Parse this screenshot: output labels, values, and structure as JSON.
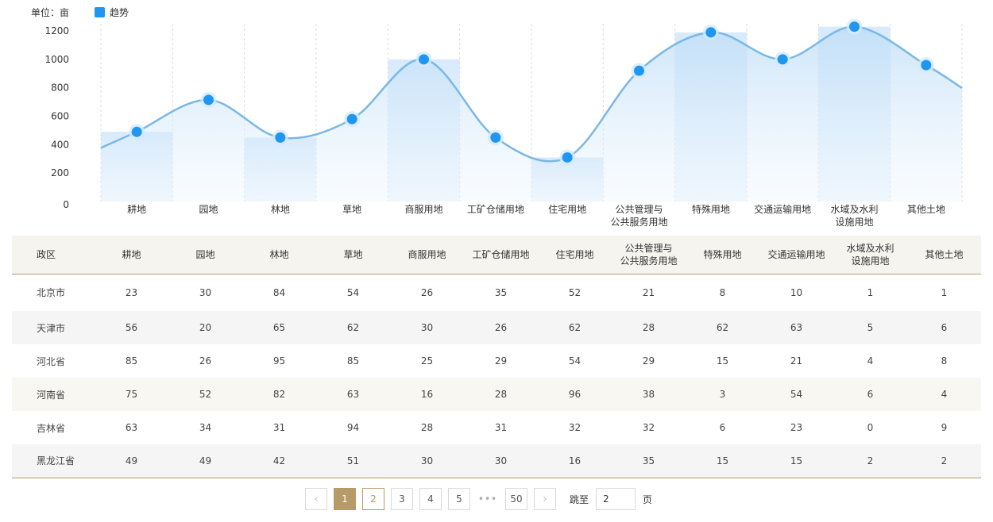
{
  "chart_data": {
    "type": "area",
    "unit_label": "单位：亩",
    "legend": [
      {
        "name": "趋势",
        "color": "#1e96f2"
      }
    ],
    "categories": [
      "耕地",
      "园地",
      "林地",
      "草地",
      "商服用地",
      "工矿仓储用地",
      "住宅用地",
      "公共管理与\n公共服务用地",
      "特殊用地",
      "交通运输用地",
      "水域及水利\n设施用地",
      "其他土地"
    ],
    "series": [
      {
        "name": "趋势",
        "values": [
          490,
          715,
          450,
          580,
          1000,
          450,
          310,
          920,
          1190,
          1000,
          1230,
          960
        ]
      }
    ],
    "ylim": [
      0,
      1200
    ],
    "yticks": [
      0,
      200,
      400,
      600,
      800,
      1000,
      1200
    ],
    "grid": "vertical-dashed",
    "line_color": "#7ab8e6",
    "point_color": "#1e96f2"
  },
  "table": {
    "headers": [
      "政区",
      "耕地",
      "园地",
      "林地",
      "草地",
      "商服用地",
      "工矿仓储用地",
      "住宅用地",
      "公共管理与\n公共服务用地",
      "特殊用地",
      "交通运输用地",
      "水域及水利\n设施用地",
      "其他土地"
    ],
    "rows": [
      [
        "北京市",
        "23",
        "30",
        "84",
        "54",
        "26",
        "35",
        "52",
        "21",
        "8",
        "10",
        "1",
        "1"
      ],
      [
        "天津市",
        "56",
        "20",
        "65",
        "62",
        "30",
        "26",
        "62",
        "28",
        "62",
        "63",
        "5",
        "6"
      ],
      [
        "河北省",
        "85",
        "26",
        "95",
        "85",
        "25",
        "29",
        "54",
        "29",
        "15",
        "21",
        "4",
        "8"
      ],
      [
        "河南省",
        "75",
        "52",
        "82",
        "63",
        "16",
        "28",
        "96",
        "38",
        "3",
        "54",
        "6",
        "4"
      ],
      [
        "吉林省",
        "63",
        "34",
        "31",
        "94",
        "28",
        "31",
        "32",
        "32",
        "6",
        "23",
        "0",
        "9"
      ],
      [
        "黑龙江省",
        "49",
        "49",
        "42",
        "51",
        "30",
        "30",
        "16",
        "35",
        "15",
        "15",
        "2",
        "2"
      ]
    ]
  },
  "pagination": {
    "prev": "‹",
    "pages": [
      "1",
      "2",
      "3",
      "4",
      "5"
    ],
    "ellipsis": "•••",
    "last": "50",
    "next": "›",
    "current": "1",
    "jump_label": "跳至",
    "jump_value": "2",
    "page_suffix": "页"
  }
}
